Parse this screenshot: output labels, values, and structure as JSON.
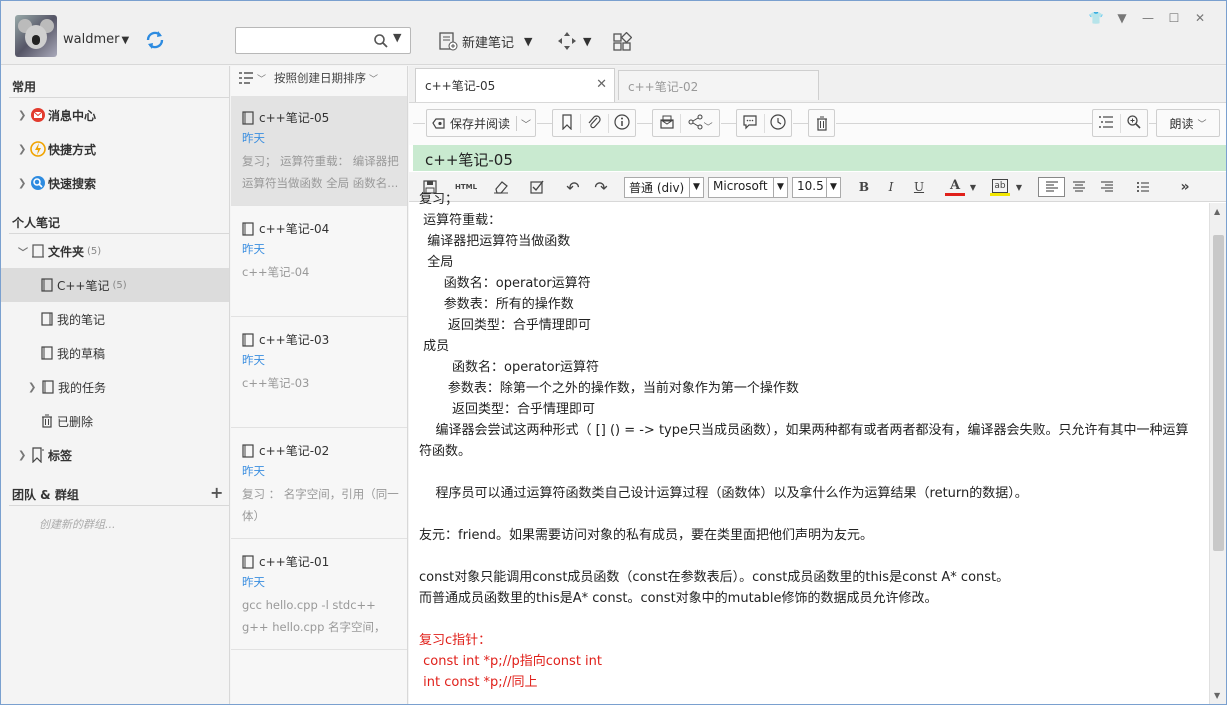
{
  "header": {
    "username": "waldmer",
    "search_placeholder": "",
    "new_note_label": "新建笔记"
  },
  "sidebar": {
    "common_title": "常用",
    "common_items": [
      {
        "label": "消息中心",
        "icon": "message-center-icon"
      },
      {
        "label": "快捷方式",
        "icon": "shortcut-icon"
      },
      {
        "label": "快速搜索",
        "icon": "quick-search-icon"
      }
    ],
    "personal_title": "个人笔记",
    "folder": {
      "label": "文件夹",
      "count": "(5)"
    },
    "folder_children": [
      {
        "label": "C++笔记",
        "count": "(5)",
        "selected": true
      },
      {
        "label": "我的笔记",
        "count": ""
      },
      {
        "label": "我的草稿",
        "count": ""
      },
      {
        "label": "我的任务",
        "count": ""
      },
      {
        "label": "已删除",
        "count": ""
      }
    ],
    "tags_label": "标签",
    "team_title": "团队 & 群组",
    "create_group_label": "创建新的群组..."
  },
  "notelist": {
    "sort_label": "按照创建日期排序",
    "notes": [
      {
        "title": "c++笔记-05",
        "date": "昨天",
        "snippet": "复习； 运算符重载： 编译器把运算符当做函数 全局 函数名..."
      },
      {
        "title": "c++笔记-04",
        "date": "昨天",
        "snippet": "c++笔记-04"
      },
      {
        "title": "c++笔记-03",
        "date": "昨天",
        "snippet": "c++笔记-03"
      },
      {
        "title": "c++笔记-02",
        "date": "昨天",
        "snippet": "复习 ： 名字空间，引用（同一体）"
      },
      {
        "title": "c++笔记-01",
        "date": "昨天",
        "snippet": "gcc hello.cpp -l stdc++ g++ hello.cpp 名字空间，nam..."
      }
    ]
  },
  "editor": {
    "tabs": [
      {
        "label": "c++笔记-05",
        "active": true
      },
      {
        "label": "c++笔记-02",
        "active": false
      }
    ],
    "save_read_label": "保存并阅读",
    "read_aloud_label": "朗读",
    "note_title": "c++笔记-05",
    "format_select": "普通 (div)",
    "font_select": "Microsoft",
    "size_select": "10.5",
    "bold": "B",
    "italic": "I",
    "underline": "U",
    "html_label": "HTML",
    "colors": {
      "font_color": "#e0201a",
      "highlight": "#f2e600",
      "title_bar": "#c9ead0",
      "link_blue": "#3a8ee0"
    },
    "content_lines": [
      {
        "text": "复习；",
        "cls": "p"
      },
      {
        "text": " 运算符重载：",
        "cls": "p"
      },
      {
        "text": "  编译器把运算符当做函数",
        "cls": "p"
      },
      {
        "text": "  全局",
        "cls": "p"
      },
      {
        "text": "      函数名：operator运算符",
        "cls": "p"
      },
      {
        "text": "      参数表：所有的操作数",
        "cls": "p"
      },
      {
        "text": "       返回类型：合乎情理即可",
        "cls": "p"
      },
      {
        "text": " 成员",
        "cls": "p"
      },
      {
        "text": "        函数名：operator运算符",
        "cls": "p"
      },
      {
        "text": "       参数表：除第一个之外的操作数，当前对象作为第一个操作数",
        "cls": "p"
      },
      {
        "text": "        返回类型：合乎情理即可",
        "cls": "p"
      },
      {
        "text": "    编译器会尝试这两种形式（ [] () = -> type只当成员函数），如果两种都有或者两者都没有，编译器会失败。只允许有其中一种运算符函数。",
        "cls": "wrap"
      },
      {
        "text": " ",
        "cls": "p"
      },
      {
        "text": "    程序员可以通过运算符函数类自己设计运算过程（函数体）以及拿什么作为运算结果（return的数据）。",
        "cls": "p"
      },
      {
        "text": " ",
        "cls": "p"
      },
      {
        "text": "友元：friend。如果需要访问对象的私有成员，要在类里面把他们声明为友元。",
        "cls": "p"
      },
      {
        "text": " ",
        "cls": "p"
      },
      {
        "text": "const对象只能调用const成员函数（const在参数表后）。const成员函数里的this是const A* const。",
        "cls": "p"
      },
      {
        "text": "而普通成员函数里的this是A* const。const对象中的mutable修饰的数据成员允许修改。",
        "cls": "p"
      },
      {
        "text": " ",
        "cls": "p"
      },
      {
        "text": "复习c指针：",
        "cls": "p red"
      },
      {
        "text": " const int *p;//p指向const int",
        "cls": "p red"
      },
      {
        "text": " int const *p;//同上",
        "cls": "p red"
      }
    ]
  }
}
